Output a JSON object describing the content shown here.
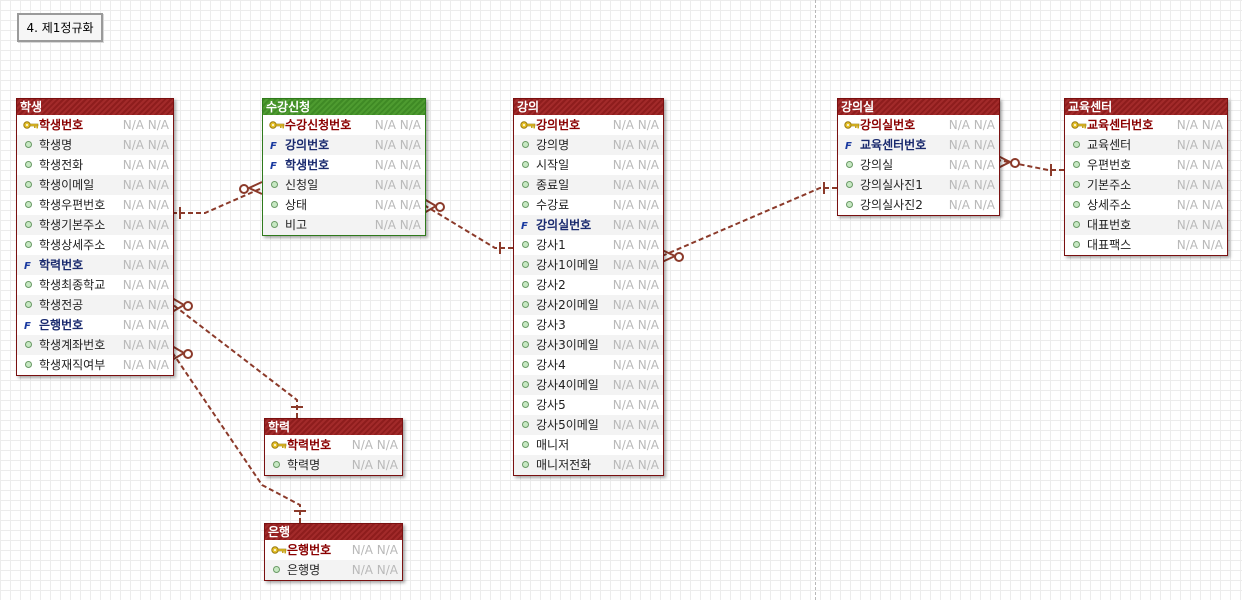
{
  "title": "4. 제1정규화",
  "na_text": "N/A N/A",
  "colors": {
    "entity_header": "#8e1d1d",
    "link_entity_header": "#3f8a25",
    "relation_line": "#8b3a2a"
  },
  "entities": [
    {
      "id": "student",
      "name": "학생",
      "style": "red",
      "attributes": [
        {
          "name": "학생번호",
          "kind": "pk"
        },
        {
          "name": "학생명",
          "kind": "attr"
        },
        {
          "name": "학생전화",
          "kind": "attr"
        },
        {
          "name": "학생이메일",
          "kind": "attr"
        },
        {
          "name": "학생우편번호",
          "kind": "attr"
        },
        {
          "name": "학생기본주소",
          "kind": "attr"
        },
        {
          "name": "학생상세주소",
          "kind": "attr"
        },
        {
          "name": "학력번호",
          "kind": "fk"
        },
        {
          "name": "학생최종학교",
          "kind": "attr"
        },
        {
          "name": "학생전공",
          "kind": "attr"
        },
        {
          "name": "은행번호",
          "kind": "fk"
        },
        {
          "name": "학생계좌번호",
          "kind": "attr"
        },
        {
          "name": "학생재직여부",
          "kind": "attr"
        }
      ]
    },
    {
      "id": "enrollment",
      "name": "수강신청",
      "style": "green",
      "attributes": [
        {
          "name": "수강신청번호",
          "kind": "pk"
        },
        {
          "name": "강의번호",
          "kind": "fk"
        },
        {
          "name": "학생번호",
          "kind": "fk"
        },
        {
          "name": "신청일",
          "kind": "attr"
        },
        {
          "name": "상태",
          "kind": "attr"
        },
        {
          "name": "비고",
          "kind": "attr"
        }
      ]
    },
    {
      "id": "lecture",
      "name": "강의",
      "style": "red",
      "attributes": [
        {
          "name": "강의번호",
          "kind": "pk"
        },
        {
          "name": "강의명",
          "kind": "attr"
        },
        {
          "name": "시작일",
          "kind": "attr"
        },
        {
          "name": "종료일",
          "kind": "attr"
        },
        {
          "name": "수강료",
          "kind": "attr"
        },
        {
          "name": "강의실번호",
          "kind": "fk"
        },
        {
          "name": "강사1",
          "kind": "attr"
        },
        {
          "name": "강사1이메일",
          "kind": "attr"
        },
        {
          "name": "강사2",
          "kind": "attr"
        },
        {
          "name": "강사2이메일",
          "kind": "attr"
        },
        {
          "name": "강사3",
          "kind": "attr"
        },
        {
          "name": "강사3이메일",
          "kind": "attr"
        },
        {
          "name": "강사4",
          "kind": "attr"
        },
        {
          "name": "강사4이메일",
          "kind": "attr"
        },
        {
          "name": "강사5",
          "kind": "attr"
        },
        {
          "name": "강사5이메일",
          "kind": "attr"
        },
        {
          "name": "매니저",
          "kind": "attr"
        },
        {
          "name": "매니저전화",
          "kind": "attr"
        }
      ]
    },
    {
      "id": "classroom",
      "name": "강의실",
      "style": "red",
      "attributes": [
        {
          "name": "강의실번호",
          "kind": "pk"
        },
        {
          "name": "교육센터번호",
          "kind": "fk"
        },
        {
          "name": "강의실",
          "kind": "attr"
        },
        {
          "name": "강의실사진1",
          "kind": "attr"
        },
        {
          "name": "강의실사진2",
          "kind": "attr"
        }
      ]
    },
    {
      "id": "center",
      "name": "교육센터",
      "style": "red",
      "attributes": [
        {
          "name": "교육센터번호",
          "kind": "pk"
        },
        {
          "name": "교육센터",
          "kind": "attr"
        },
        {
          "name": "우편번호",
          "kind": "attr"
        },
        {
          "name": "기본주소",
          "kind": "attr"
        },
        {
          "name": "상세주소",
          "kind": "attr"
        },
        {
          "name": "대표번호",
          "kind": "attr"
        },
        {
          "name": "대표팩스",
          "kind": "attr"
        }
      ]
    },
    {
      "id": "education",
      "name": "학력",
      "style": "red",
      "attributes": [
        {
          "name": "학력번호",
          "kind": "pk"
        },
        {
          "name": "학력명",
          "kind": "attr"
        }
      ]
    },
    {
      "id": "bank",
      "name": "은행",
      "style": "red",
      "attributes": [
        {
          "name": "은행번호",
          "kind": "pk"
        },
        {
          "name": "은행명",
          "kind": "attr"
        }
      ]
    }
  ],
  "relationships": [
    {
      "from": "student",
      "to": "enrollment",
      "from_end": "one",
      "to_end": "zero-or-many"
    },
    {
      "from": "lecture",
      "to": "enrollment",
      "from_end": "one",
      "to_end": "zero-or-many"
    },
    {
      "from": "classroom",
      "to": "lecture",
      "from_end": "one",
      "to_end": "zero-or-many"
    },
    {
      "from": "center",
      "to": "classroom",
      "from_end": "one",
      "to_end": "zero-or-many"
    },
    {
      "from": "education",
      "to": "student",
      "from_end": "one",
      "to_end": "zero-or-many"
    },
    {
      "from": "bank",
      "to": "student",
      "from_end": "one",
      "to_end": "zero-or-many"
    }
  ]
}
